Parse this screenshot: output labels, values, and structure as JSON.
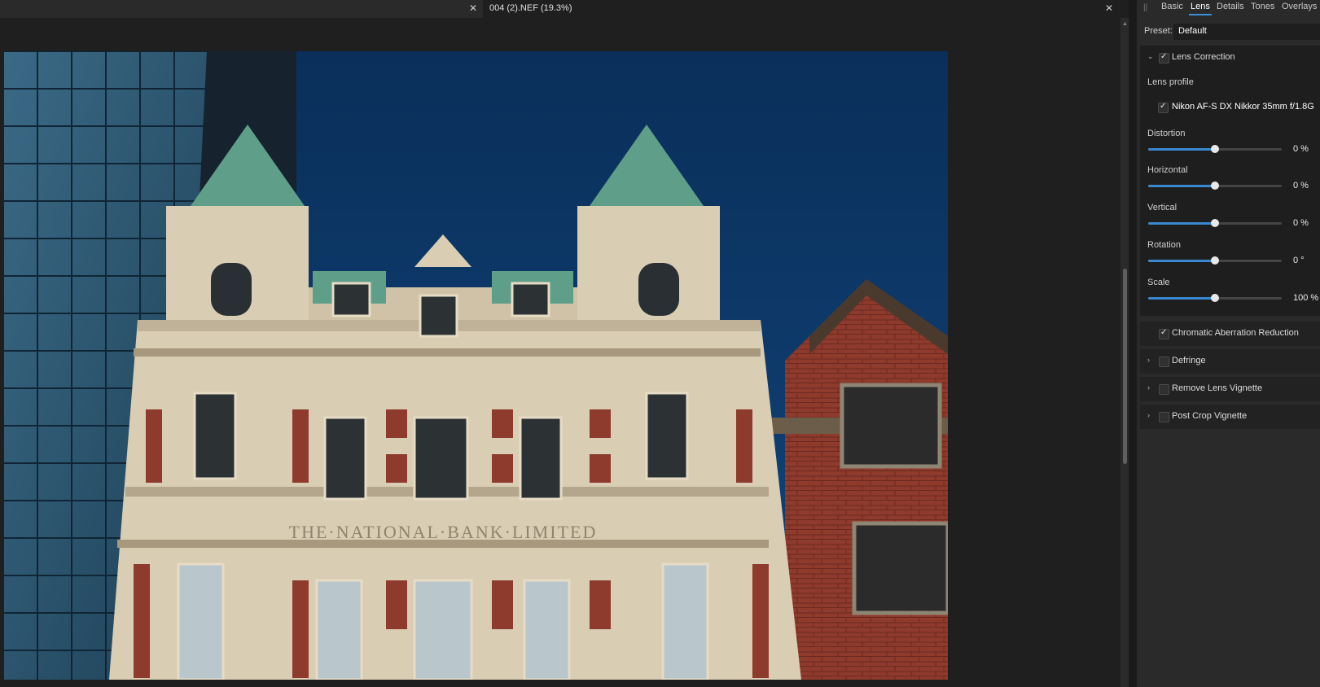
{
  "document_tab": {
    "title": "004 (2).NEF (19.3%)"
  },
  "panel": {
    "tabs": [
      "Basic",
      "Lens",
      "Details",
      "Tones",
      "Overlays"
    ],
    "active_tab": "Lens",
    "preset": {
      "label": "Preset:",
      "value": "Default"
    },
    "lens_correction": {
      "title": "Lens Correction",
      "enabled": true,
      "expanded": true,
      "lens_profile_label": "Lens profile",
      "lens_profile_enabled": true,
      "lens_profile": "Nikon AF-S DX Nikkor 35mm f/1.8G",
      "sliders": [
        {
          "label": "Distortion",
          "value": "0 %",
          "position": 0.5
        },
        {
          "label": "Horizontal",
          "value": "0 %",
          "position": 0.5
        },
        {
          "label": "Vertical",
          "value": "0 %",
          "position": 0.5
        },
        {
          "label": "Rotation",
          "value": "0 °",
          "position": 0.5
        },
        {
          "label": "Scale",
          "value": "100 %",
          "position": 0.5
        }
      ]
    },
    "sections": [
      {
        "title": "Chromatic Aberration Reduction",
        "enabled": true,
        "has_chevron": false
      },
      {
        "title": "Defringe",
        "enabled": false,
        "has_chevron": true
      },
      {
        "title": "Remove Lens Vignette",
        "enabled": false,
        "has_chevron": true
      },
      {
        "title": "Post Crop Vignette",
        "enabled": false,
        "has_chevron": true
      }
    ]
  },
  "photo": {
    "engraving": "THE·NATIONAL·BANK·LIMITED"
  },
  "colors": {
    "accent": "#3a88d0",
    "sky": "#0d3763",
    "stone": "#d9cdb4",
    "brick": "#8e3a2c",
    "copper": "#5f9e88"
  }
}
